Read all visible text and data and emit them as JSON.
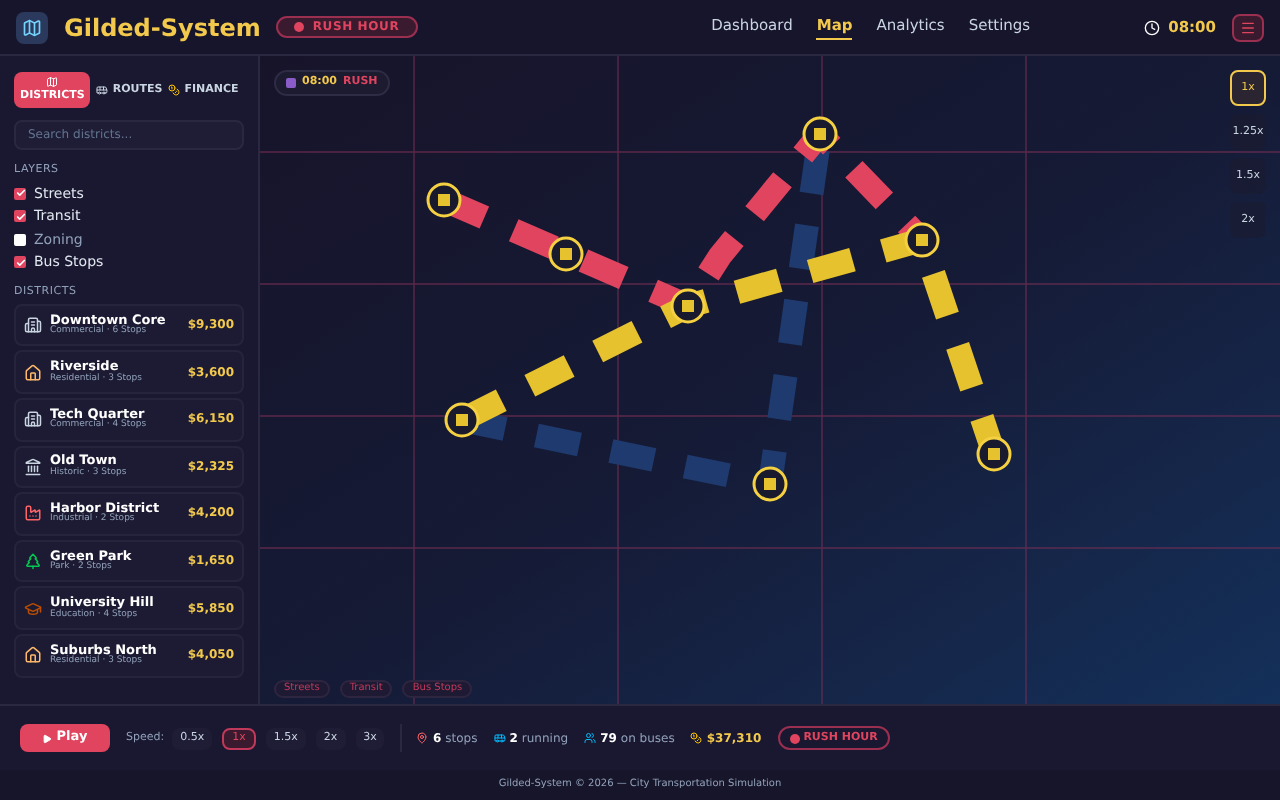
{
  "header": {
    "title": "Gilded-System",
    "badge": "RUSH HOUR",
    "nav": [
      {
        "label": "Dashboard",
        "selected": false
      },
      {
        "label": "Map",
        "selected": true
      },
      {
        "label": "Analytics",
        "selected": false
      },
      {
        "label": "Settings",
        "selected": false
      }
    ],
    "clock": "08:00"
  },
  "sidebar": {
    "tabs": [
      {
        "label": "DISTRICTS",
        "kind": "map",
        "selected": true
      },
      {
        "label": "ROUTES",
        "kind": "bus",
        "selected": false
      },
      {
        "label": "FINANCE",
        "kind": "money",
        "selected": false
      }
    ],
    "search": {
      "placeholder": "Search districts..."
    },
    "layers_title": "LAYERS",
    "layers": [
      {
        "label": "Streets",
        "checked": true
      },
      {
        "label": "Transit",
        "checked": true
      },
      {
        "label": "Zoning",
        "checked": false
      },
      {
        "label": "Bus Stops",
        "checked": true
      }
    ],
    "districts_title": "DISTRICTS",
    "districts": [
      {
        "name": "Downtown Core",
        "info": "Commercial · 6 Stops",
        "amount": "$9,300",
        "kind": "office"
      },
      {
        "name": "Riverside",
        "info": "Residential · 3 Stops",
        "amount": "$3,600",
        "kind": "houses"
      },
      {
        "name": "Tech Quarter",
        "info": "Commercial · 4 Stops",
        "amount": "$6,150",
        "kind": "office"
      },
      {
        "name": "Old Town",
        "info": "Historic · 3 Stops",
        "amount": "$2,325",
        "kind": "landmark"
      },
      {
        "name": "Harbor District",
        "info": "Industrial · 2 Stops",
        "amount": "$4,200",
        "kind": "factory"
      },
      {
        "name": "Green Park",
        "info": "Park · 2 Stops",
        "amount": "$1,650",
        "kind": "tree"
      },
      {
        "name": "University Hill",
        "info": "Education · 4 Stops",
        "amount": "$5,850",
        "kind": "school"
      },
      {
        "name": "Suburbs North",
        "info": "Residential · 3 Stops",
        "amount": "$4,050",
        "kind": "houses"
      }
    ]
  },
  "map": {
    "clock": "08:00",
    "status": "RUSH",
    "zoom": [
      {
        "label": "1x",
        "selected": true
      },
      {
        "label": "1.25x",
        "selected": false
      },
      {
        "label": "1.5x",
        "selected": false
      },
      {
        "label": "2x",
        "selected": false
      }
    ],
    "legend": [
      "Streets",
      "Transit",
      "Bus Stops"
    ]
  },
  "controls": {
    "play": "Play",
    "speed_label": "Speed:",
    "speeds": [
      {
        "label": "0.5x",
        "selected": false
      },
      {
        "label": "1x",
        "selected": true
      },
      {
        "label": "1.5x",
        "selected": false
      },
      {
        "label": "2x",
        "selected": false
      },
      {
        "label": "3x",
        "selected": false
      }
    ],
    "stats": [
      {
        "kind": "pin",
        "value": "6",
        "label": "stops"
      },
      {
        "kind": "bus",
        "value": "2",
        "label": "running"
      },
      {
        "kind": "people",
        "value": "79",
        "label": "on buses"
      },
      {
        "kind": "money",
        "value": "$37,310"
      }
    ],
    "badge": "RUSH HOUR"
  },
  "footer": "Gilded-System © 2026 — City Transportation Simulation"
}
